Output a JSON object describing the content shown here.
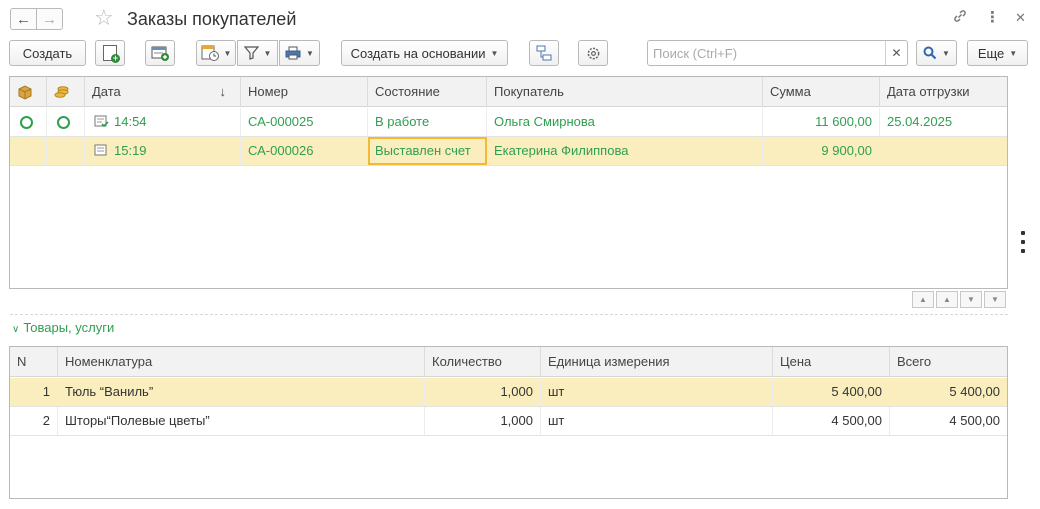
{
  "window": {
    "title": "Заказы покупателей"
  },
  "toolbar": {
    "create_label": "Создать",
    "create_based_label": "Создать на основании",
    "more_label": "Еще",
    "search_placeholder": "Поиск (Ctrl+F)"
  },
  "orders": {
    "columns": [
      "Дата",
      "Номер",
      "Состояние",
      "Покупатель",
      "Сумма",
      "Дата отгрузки"
    ],
    "sort_indicator": "↓",
    "rows": [
      {
        "time": "14:54",
        "number": "СА-000025",
        "status": "В работе",
        "customer": "Ольга Смирнова",
        "sum": "11 600,00",
        "ship_date": "25.04.2025"
      },
      {
        "time": "15:19",
        "number": "СА-000026",
        "status": "Выставлен счет",
        "customer": "Екатерина Филиппова",
        "sum": "9 900,00",
        "ship_date": ""
      }
    ]
  },
  "goods": {
    "section_label": "Товары, услуги",
    "columns": [
      "N",
      "Номенклатура",
      "Количество",
      "Единица измерения",
      "Цена",
      "Всего"
    ],
    "rows": [
      {
        "n": "1",
        "item": "Тюль “Ваниль”",
        "qty": "1,000",
        "unit": "шт",
        "price": "5 400,00",
        "total": "5 400,00"
      },
      {
        "n": "2",
        "item": "Шторы“Полевые цветы”",
        "qty": "1,000",
        "unit": "шт",
        "price": "4 500,00",
        "total": "4 500,00"
      }
    ]
  },
  "colors": {
    "accent_green": "#2e9f4f",
    "selection": "#fbeebe",
    "focus": "#f3b936"
  },
  "icons": [
    "back-arrow-icon",
    "forward-arrow-icon",
    "star-icon",
    "link-icon",
    "more-vert-icon",
    "close-icon",
    "add-copy-icon",
    "add-report-icon",
    "calendar-status-icon",
    "filter-icon",
    "print-icon",
    "structure-icon",
    "settings-gear-icon",
    "search-icon"
  ]
}
